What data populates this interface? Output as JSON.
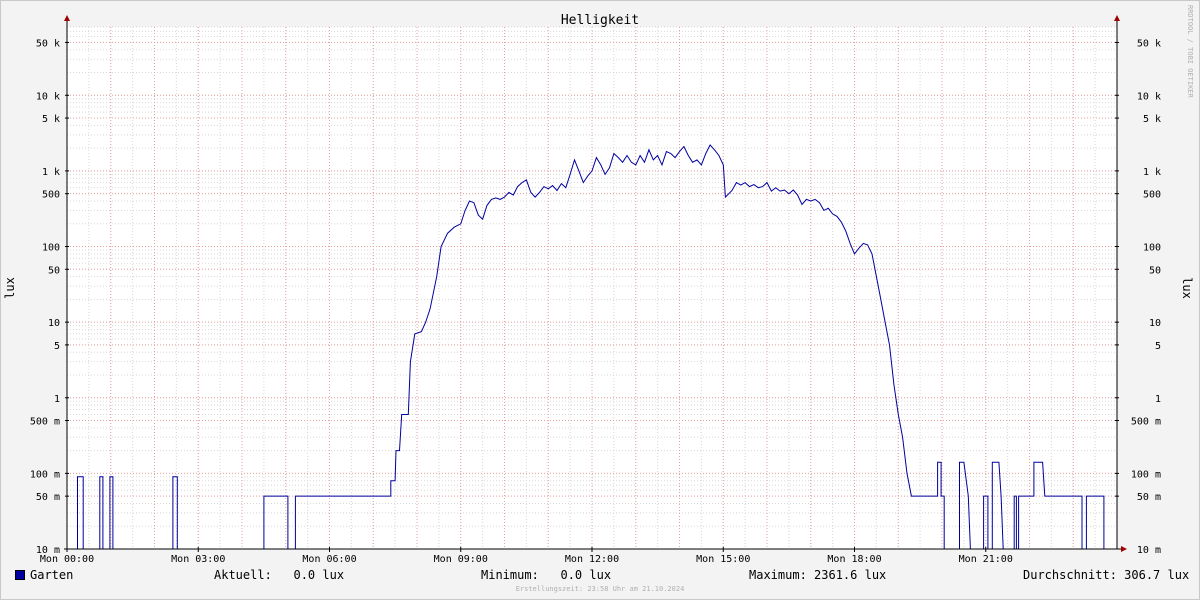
{
  "watermark": "RRDTOOL / TOBI OETIKER",
  "legend": {
    "series_name": "Garten",
    "current": "Aktuell:   0.0 lux",
    "minimum": "Minimum:   0.0 lux",
    "maximum": "Maximum: 2361.6 lux",
    "average": "Durchschnitt: 306.7 lux"
  },
  "created_at": "Erstellungszeit: 23:58 Uhr am 21.10.2024",
  "colors": {
    "line": "#0000a0",
    "grid_major": "#e8a0a0",
    "grid_minor": "#d8d8d8",
    "axis": "#000000",
    "arrow": "#a00000"
  },
  "chart_data": {
    "type": "line",
    "title": "Helligkeit",
    "ylabel": "lux",
    "y_scale": "log",
    "ylim": [
      0.01,
      80000
    ],
    "xlim": [
      0,
      24
    ],
    "x_unit": "hours since Mon 00:00",
    "x_ticks": [
      {
        "x": 0,
        "label": "Mon 00:00"
      },
      {
        "x": 3,
        "label": "Mon 03:00"
      },
      {
        "x": 6,
        "label": "Mon 06:00"
      },
      {
        "x": 9,
        "label": "Mon 09:00"
      },
      {
        "x": 12,
        "label": "Mon 12:00"
      },
      {
        "x": 15,
        "label": "Mon 15:00"
      },
      {
        "x": 18,
        "label": "Mon 18:00"
      },
      {
        "x": 21,
        "label": "Mon 21:00"
      }
    ],
    "y_ticks": [
      {
        "v": 0.01,
        "label": "10 m"
      },
      {
        "v": 0.05,
        "label": "50 m"
      },
      {
        "v": 0.1,
        "label": "100 m"
      },
      {
        "v": 0.5,
        "label": "500 m"
      },
      {
        "v": 1,
        "label": "1"
      },
      {
        "v": 5,
        "label": "5"
      },
      {
        "v": 10,
        "label": "10"
      },
      {
        "v": 50,
        "label": "50"
      },
      {
        "v": 100,
        "label": "100"
      },
      {
        "v": 500,
        "label": "500"
      },
      {
        "v": 1000,
        "label": "1 k"
      },
      {
        "v": 5000,
        "label": "5 k"
      },
      {
        "v": 10000,
        "label": "10 k"
      },
      {
        "v": 50000,
        "label": "50 k"
      }
    ],
    "series": [
      {
        "name": "Garten",
        "points": [
          [
            0.0,
            0.01
          ],
          [
            0.24,
            0.01
          ],
          [
            0.24,
            0.09
          ],
          [
            0.37,
            0.09
          ],
          [
            0.37,
            0.01
          ],
          [
            0.75,
            0.01
          ],
          [
            0.75,
            0.09
          ],
          [
            0.82,
            0.09
          ],
          [
            0.82,
            0.01
          ],
          [
            0.98,
            0.01
          ],
          [
            0.98,
            0.09
          ],
          [
            1.05,
            0.09
          ],
          [
            1.05,
            0.01
          ],
          [
            2.42,
            0.01
          ],
          [
            2.42,
            0.09
          ],
          [
            2.52,
            0.09
          ],
          [
            2.52,
            0.01
          ],
          [
            4.5,
            0.01
          ],
          [
            4.5,
            0.05
          ],
          [
            5.05,
            0.05
          ],
          [
            5.05,
            0.01
          ],
          [
            5.22,
            0.01
          ],
          [
            5.22,
            0.05
          ],
          [
            7.4,
            0.05
          ],
          [
            7.4,
            0.08
          ],
          [
            7.5,
            0.08
          ],
          [
            7.52,
            0.2
          ],
          [
            7.6,
            0.2
          ],
          [
            7.65,
            0.6
          ],
          [
            7.8,
            0.6
          ],
          [
            7.85,
            3
          ],
          [
            7.95,
            7
          ],
          [
            8.1,
            7.5
          ],
          [
            8.2,
            10
          ],
          [
            8.3,
            15
          ],
          [
            8.45,
            40
          ],
          [
            8.55,
            100
          ],
          [
            8.7,
            150
          ],
          [
            8.85,
            180
          ],
          [
            9.0,
            200
          ],
          [
            9.1,
            300
          ],
          [
            9.2,
            400
          ],
          [
            9.3,
            380
          ],
          [
            9.4,
            260
          ],
          [
            9.5,
            230
          ],
          [
            9.6,
            350
          ],
          [
            9.7,
            420
          ],
          [
            9.8,
            440
          ],
          [
            9.9,
            420
          ],
          [
            10.0,
            450
          ],
          [
            10.1,
            520
          ],
          [
            10.2,
            480
          ],
          [
            10.3,
            620
          ],
          [
            10.4,
            700
          ],
          [
            10.5,
            760
          ],
          [
            10.6,
            520
          ],
          [
            10.7,
            450
          ],
          [
            10.8,
            520
          ],
          [
            10.9,
            620
          ],
          [
            11.0,
            580
          ],
          [
            11.1,
            640
          ],
          [
            11.2,
            550
          ],
          [
            11.3,
            680
          ],
          [
            11.4,
            600
          ],
          [
            11.5,
            900
          ],
          [
            11.6,
            1400
          ],
          [
            11.7,
            1000
          ],
          [
            11.8,
            700
          ],
          [
            11.9,
            850
          ],
          [
            12.0,
            1000
          ],
          [
            12.1,
            1500
          ],
          [
            12.2,
            1200
          ],
          [
            12.3,
            900
          ],
          [
            12.4,
            1100
          ],
          [
            12.5,
            1700
          ],
          [
            12.6,
            1500
          ],
          [
            12.7,
            1300
          ],
          [
            12.8,
            1600
          ],
          [
            12.9,
            1300
          ],
          [
            13.0,
            1200
          ],
          [
            13.1,
            1600
          ],
          [
            13.2,
            1300
          ],
          [
            13.3,
            1900
          ],
          [
            13.4,
            1400
          ],
          [
            13.5,
            1600
          ],
          [
            13.6,
            1200
          ],
          [
            13.7,
            1800
          ],
          [
            13.8,
            1700
          ],
          [
            13.9,
            1500
          ],
          [
            14.0,
            1800
          ],
          [
            14.1,
            2100
          ],
          [
            14.2,
            1600
          ],
          [
            14.3,
            1300
          ],
          [
            14.4,
            1400
          ],
          [
            14.5,
            1200
          ],
          [
            14.6,
            1700
          ],
          [
            14.7,
            2200
          ],
          [
            14.8,
            1900
          ],
          [
            14.9,
            1600
          ],
          [
            15.0,
            1200
          ],
          [
            15.05,
            450
          ],
          [
            15.2,
            550
          ],
          [
            15.3,
            700
          ],
          [
            15.4,
            650
          ],
          [
            15.5,
            700
          ],
          [
            15.6,
            620
          ],
          [
            15.7,
            660
          ],
          [
            15.8,
            600
          ],
          [
            15.9,
            620
          ],
          [
            16.0,
            700
          ],
          [
            16.1,
            540
          ],
          [
            16.2,
            600
          ],
          [
            16.3,
            540
          ],
          [
            16.4,
            560
          ],
          [
            16.5,
            500
          ],
          [
            16.6,
            560
          ],
          [
            16.7,
            480
          ],
          [
            16.8,
            360
          ],
          [
            16.9,
            420
          ],
          [
            17.0,
            400
          ],
          [
            17.1,
            420
          ],
          [
            17.2,
            380
          ],
          [
            17.3,
            300
          ],
          [
            17.4,
            320
          ],
          [
            17.5,
            270
          ],
          [
            17.6,
            250
          ],
          [
            17.7,
            210
          ],
          [
            17.8,
            160
          ],
          [
            17.9,
            110
          ],
          [
            18.0,
            80
          ],
          [
            18.1,
            95
          ],
          [
            18.2,
            110
          ],
          [
            18.3,
            105
          ],
          [
            18.4,
            80
          ],
          [
            18.5,
            40
          ],
          [
            18.6,
            20
          ],
          [
            18.7,
            10
          ],
          [
            18.8,
            5
          ],
          [
            18.9,
            1.5
          ],
          [
            19.0,
            0.6
          ],
          [
            19.1,
            0.3
          ],
          [
            19.2,
            0.1
          ],
          [
            19.3,
            0.05
          ],
          [
            19.4,
            0.05
          ],
          [
            19.5,
            0.05
          ],
          [
            19.6,
            0.05
          ],
          [
            19.9,
            0.05
          ],
          [
            19.9,
            0.14
          ],
          [
            19.98,
            0.14
          ],
          [
            19.98,
            0.05
          ],
          [
            20.05,
            0.05
          ],
          [
            20.05,
            0.01
          ],
          [
            20.4,
            0.01
          ],
          [
            20.4,
            0.14
          ],
          [
            20.5,
            0.14
          ],
          [
            20.6,
            0.05
          ],
          [
            20.65,
            0.01
          ],
          [
            20.95,
            0.01
          ],
          [
            20.95,
            0.05
          ],
          [
            21.05,
            0.05
          ],
          [
            21.05,
            0.01
          ],
          [
            21.15,
            0.01
          ],
          [
            21.15,
            0.14
          ],
          [
            21.3,
            0.14
          ],
          [
            21.35,
            0.05
          ],
          [
            21.4,
            0.01
          ],
          [
            21.65,
            0.01
          ],
          [
            21.65,
            0.05
          ],
          [
            21.7,
            0.05
          ],
          [
            21.7,
            0.01
          ],
          [
            21.75,
            0.01
          ],
          [
            21.75,
            0.05
          ],
          [
            22.1,
            0.05
          ],
          [
            22.1,
            0.14
          ],
          [
            22.3,
            0.14
          ],
          [
            22.35,
            0.05
          ],
          [
            23.2,
            0.05
          ],
          [
            23.2,
            0.01
          ],
          [
            23.3,
            0.01
          ],
          [
            23.3,
            0.05
          ],
          [
            23.7,
            0.05
          ],
          [
            23.7,
            0.01
          ],
          [
            24.0,
            0.01
          ]
        ]
      }
    ]
  }
}
